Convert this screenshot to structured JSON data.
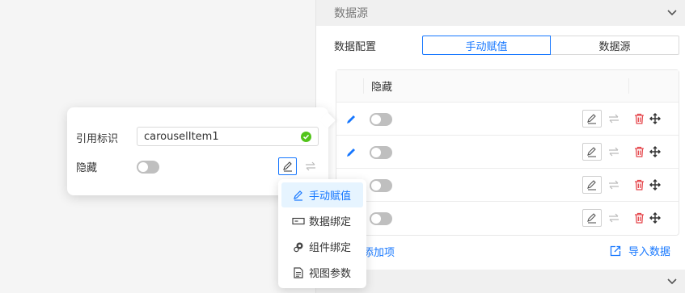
{
  "right_panel": {
    "section_title": "数据源",
    "config_label": "数据配置",
    "segment": {
      "options": [
        "手动赋值",
        "数据源"
      ],
      "selected": "手动赋值"
    },
    "list": {
      "header_label": "隐藏",
      "rows": [
        {
          "hidden": false
        },
        {
          "hidden": false
        },
        {
          "hidden": false
        },
        {
          "hidden": false
        }
      ]
    },
    "add_item_label": "添加项",
    "import_label": "导入数据"
  },
  "popover": {
    "ref_label": "引用标识",
    "ref_value": "carouselItem1",
    "hide_label": "隐藏",
    "hide_value": false
  },
  "dropdown": {
    "items": [
      {
        "label": "手动赋值",
        "icon": "pen-icon",
        "active": true
      },
      {
        "label": "数据绑定",
        "icon": "data-bind-icon",
        "active": false
      },
      {
        "label": "组件绑定",
        "icon": "component-bind-icon",
        "active": false
      },
      {
        "label": "视图参数",
        "icon": "document-icon",
        "active": false
      }
    ]
  },
  "colors": {
    "accent": "#1677ff",
    "success": "#52c41a",
    "danger": "#e5484d",
    "toggle_off": "#bfbfbf"
  }
}
